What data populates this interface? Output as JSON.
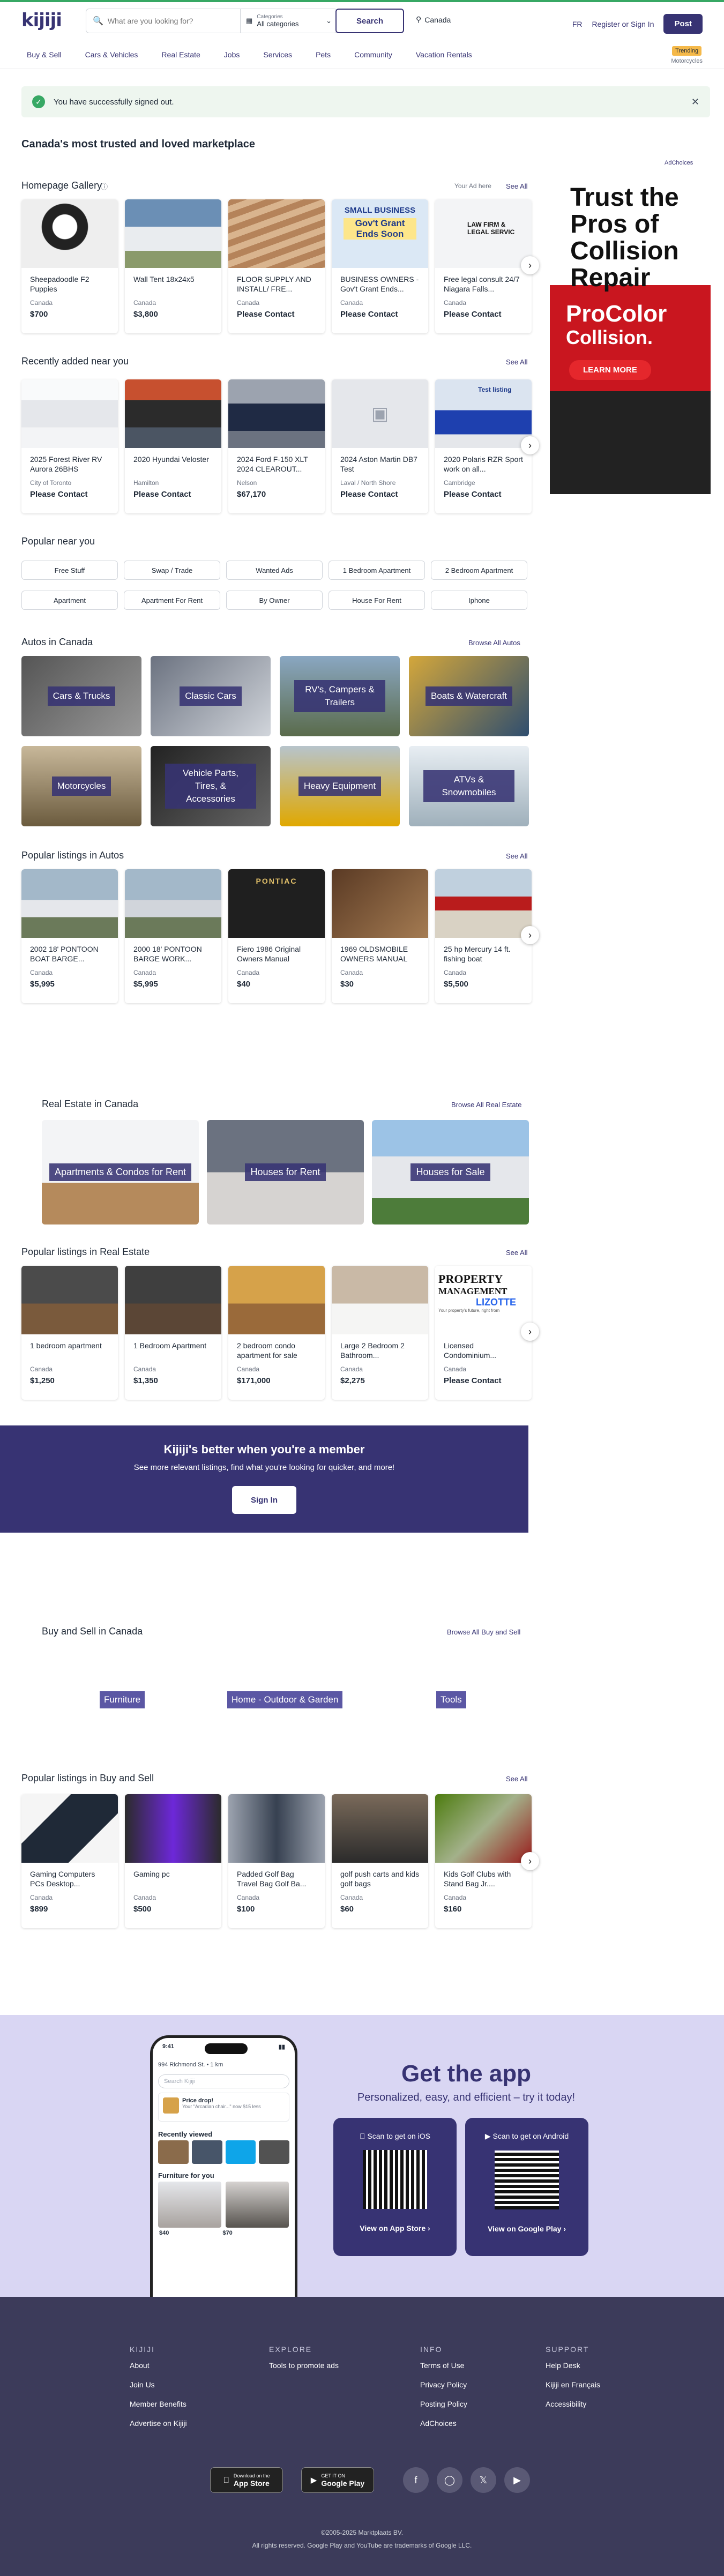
{
  "header": {
    "logo": "kijiji",
    "search_placeholder": "What are you looking for?",
    "cat_label": "Categories",
    "cat_value": "All categories",
    "search_btn": "Search",
    "location": "Canada",
    "lang": "FR",
    "register": "Register",
    "or": "or",
    "signin": "Sign In",
    "post": "Post",
    "trending_badge": "Trending",
    "trending_sub": "Motorcycles",
    "nav": [
      "Buy & Sell",
      "Cars & Vehicles",
      "Real Estate",
      "Jobs",
      "Services",
      "Pets",
      "Community",
      "Vacation Rentals"
    ]
  },
  "alert": "You have successfully signed out.",
  "headline": "Canada's most trusted and loved marketplace",
  "adchoices": "AdChoices",
  "gallery": {
    "title": "Homepage Gallery",
    "your_ad": "Your Ad here",
    "see_all": "See All",
    "items": [
      {
        "t": "Sheepadoodle F2 Puppies",
        "l": "Canada",
        "p": "$700"
      },
      {
        "t": "Wall Tent 18x24x5",
        "l": "Canada",
        "p": "$3,800"
      },
      {
        "t": "FLOOR SUPPLY AND INSTALL/ FRE...",
        "l": "Canada",
        "p": "Please Contact"
      },
      {
        "t": "BUSINESS OWNERS - Gov't Grant Ends...",
        "l": "Canada",
        "p": "Please Contact"
      },
      {
        "t": "Free legal consult 24/7 Niagara Falls...",
        "l": "Canada",
        "p": "Please Contact"
      }
    ]
  },
  "gallery_img_text": {
    "biz1": "SMALL BUSINESS",
    "biz2": "Gov't Grant Ends Soon",
    "law": "LAW FIRM & LEGAL SERVIC"
  },
  "recent": {
    "title": "Recently added near you",
    "see_all": "See All",
    "items": [
      {
        "t": "2025 Forest River RV Aurora 26BHS",
        "l": "City of Toronto",
        "p": "Please Contact"
      },
      {
        "t": "2020 Hyundai Veloster",
        "l": "Hamilton",
        "p": "Please Contact"
      },
      {
        "t": "2024 Ford F-150 XLT 2024 CLEAROUT...",
        "l": "Nelson",
        "p": "$67,170"
      },
      {
        "t": "2024 Aston Martin DB7 Test",
        "l": "Laval / North Shore",
        "p": "Please Contact"
      },
      {
        "t": "2020 Polaris RZR Sport work on all...",
        "l": "Cambridge",
        "p": "Please Contact"
      }
    ],
    "test_listing": "Test listing"
  },
  "ad": {
    "headline": "Trust the Pros of Collision Repair",
    "brand1": "ProColor",
    "brand2": "Collision.",
    "cta": "LEARN MORE"
  },
  "popular_near": {
    "title": "Popular near you",
    "items": [
      "Free Stuff",
      "Swap / Trade",
      "Wanted Ads",
      "1 Bedroom Apartment",
      "2 Bedroom Apartment",
      "Apartment",
      "Apartment For Rent",
      "By Owner",
      "House For Rent",
      "Iphone"
    ]
  },
  "autos": {
    "title": "Autos in Canada",
    "browse": "Browse All Autos",
    "tiles": [
      "Cars & Trucks",
      "Classic Cars",
      "RV's, Campers & Trailers",
      "Boats & Watercraft",
      "Motorcycles",
      "Vehicle Parts, Tires, & Accessories",
      "Heavy Equipment",
      "ATVs & Snowmobiles"
    ]
  },
  "pop_autos": {
    "title": "Popular listings in Autos",
    "see_all": "See All",
    "items": [
      {
        "t": "2002 18' PONTOON BOAT BARGE...",
        "l": "Canada",
        "p": "$5,995"
      },
      {
        "t": "2000 18' PONTOON BARGE WORK...",
        "l": "Canada",
        "p": "$5,995"
      },
      {
        "t": "Fiero 1986 Original Owners Manual",
        "l": "Canada",
        "p": "$40"
      },
      {
        "t": "1969 OLDSMOBILE OWNERS MANUAL",
        "l": "Canada",
        "p": "$30"
      },
      {
        "t": "25 hp Mercury 14 ft. fishing boat",
        "l": "Canada",
        "p": "$5,500"
      }
    ],
    "img_text": {
      "pontiac": "PONTIAC"
    }
  },
  "realestate": {
    "title": "Real Estate in Canada",
    "browse": "Browse All Real Estate",
    "tiles": [
      "Apartments & Condos for Rent",
      "Houses for Rent",
      "Houses for Sale"
    ]
  },
  "pop_re": {
    "title": "Popular listings in Real Estate",
    "see_all": "See All",
    "items": [
      {
        "t": "1 bedroom apartment",
        "l": "Canada",
        "p": "$1,250"
      },
      {
        "t": "1 Bedroom Apartment",
        "l": "Canada",
        "p": "$1,350"
      },
      {
        "t": "2 bedroom condo apartment for sale",
        "l": "Canada",
        "p": "$171,000"
      },
      {
        "t": "Large 2 Bedroom 2 Bathroom...",
        "l": "Canada",
        "p": "$2,275"
      },
      {
        "t": "Licensed Condominium...",
        "l": "Canada",
        "p": "Please Contact"
      }
    ],
    "img_text": {
      "prop1": "PROPERTY",
      "prop2": "MANAGEMENT",
      "prop3": "LIZOTTE",
      "prop4": "Your property's future, right from"
    }
  },
  "member": {
    "title": "Kijiji's better when you're a member",
    "body": "See more relevant listings, find what you're looking for quicker, and more!",
    "btn": "Sign In"
  },
  "buysell": {
    "title": "Buy and Sell in Canada",
    "browse": "Browse All Buy and Sell",
    "tags": [
      "Furniture",
      "Home - Outdoor & Garden",
      "Tools"
    ]
  },
  "pop_bs": {
    "title": "Popular listings in Buy and Sell",
    "see_all": "See All",
    "items": [
      {
        "t": "Gaming Computers PCs Desktop...",
        "l": "Canada",
        "p": "$899"
      },
      {
        "t": "Gaming pc",
        "l": "Canada",
        "p": "$500"
      },
      {
        "t": "Padded Golf Bag Travel Bag Golf Ba...",
        "l": "Canada",
        "p": "$100"
      },
      {
        "t": "golf push carts and kids golf bags",
        "l": "Canada",
        "p": "$60"
      },
      {
        "t": "Kids Golf Clubs with Stand Bag Jr....",
        "l": "Canada",
        "p": "$160"
      }
    ]
  },
  "app": {
    "title": "Get the app",
    "sub": "Personalized, easy, and efficient – try it today!",
    "ios_top": "Scan to get on iOS",
    "ios_bot": "View on App Store",
    "and_top": "Scan to get on Android",
    "and_bot": "View on Google Play",
    "phone": {
      "time": "9:41",
      "addr": "994 Richmond St. • 1 km",
      "search": "Search Kijiji",
      "price": "Price drop!",
      "price_sub": "Your \"Arcadian chair...\" now $15 less",
      "recent": "Recently viewed",
      "furniture": "Furniture for you",
      "p1": "$40",
      "p2": "$70"
    }
  },
  "footer": {
    "cols": [
      {
        "h": "KIJIJI",
        "links": [
          "About",
          "Join Us",
          "Member Benefits",
          "Advertise on Kijiji"
        ]
      },
      {
        "h": "EXPLORE",
        "links": [
          "Tools to promote ads"
        ]
      },
      {
        "h": "INFO",
        "links": [
          "Terms of Use",
          "Privacy Policy",
          "Posting Policy",
          "AdChoices"
        ]
      },
      {
        "h": "SUPPORT",
        "links": [
          "Help Desk",
          "Kijiji en Français",
          "Accessibility"
        ]
      }
    ],
    "appstore_small": "Download on the",
    "appstore": "App Store",
    "gplay_small": "GET IT ON",
    "gplay": "Google Play",
    "copy": "©2005-2025 Marktplaats BV.",
    "rights": "All rights reserved. Google Play and YouTube are trademarks of Google LLC."
  },
  "colors": {
    "brand": "#373373",
    "green": "#37a864",
    "footer": "#3c3b5a",
    "app_bg": "#d9d6f3"
  }
}
